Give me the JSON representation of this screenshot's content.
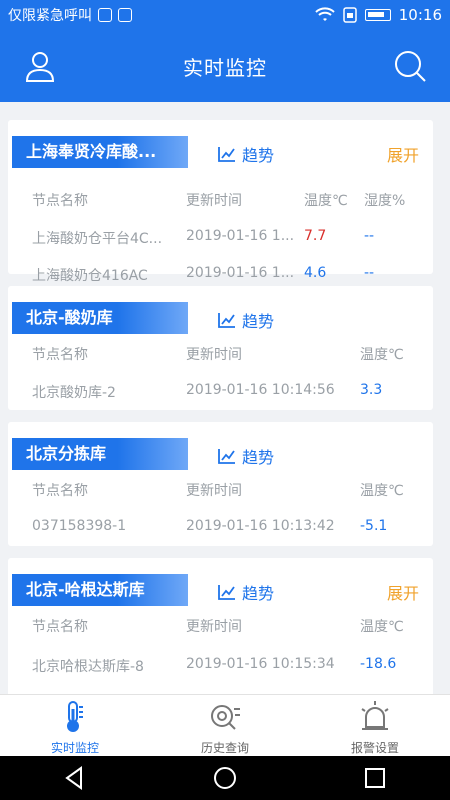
{
  "status_bar": {
    "carrier": "仅限紧急呼叫",
    "time": "10:16"
  },
  "header": {
    "title": "实时监控"
  },
  "cards": [
    {
      "name": "上海奉贤冷库酸...",
      "trend_label": "趋势",
      "expand_label": "展开",
      "headers": {
        "node": "节点名称",
        "time": "更新时间",
        "temp": "温度℃",
        "humidity": "湿度%"
      },
      "rows": [
        {
          "node": "上海酸奶仓平台4C...",
          "time": "2019-01-16 1...",
          "temp": "7.7",
          "humidity": "--"
        },
        {
          "node": "上海酸奶仓416AC",
          "time": "2019-01-16 1...",
          "temp": "4.6",
          "humidity": "--"
        }
      ]
    },
    {
      "name": "北京-酸奶库",
      "trend_label": "趋势",
      "headers": {
        "node": "节点名称",
        "time": "更新时间",
        "temp": "温度℃"
      },
      "rows": [
        {
          "node": "北京酸奶库-2",
          "time": "2019-01-16 10:14:56",
          "temp": "3.3"
        }
      ]
    },
    {
      "name": "北京分拣库",
      "trend_label": "趋势",
      "headers": {
        "node": "节点名称",
        "time": "更新时间",
        "temp": "温度℃"
      },
      "rows": [
        {
          "node": "037158398-1",
          "time": "2019-01-16 10:13:42",
          "temp": "-5.1"
        }
      ]
    },
    {
      "name": "北京-哈根达斯库",
      "trend_label": "趋势",
      "expand_label": "展开",
      "headers": {
        "node": "节点名称",
        "time": "更新时间",
        "temp": "温度℃"
      },
      "rows": [
        {
          "node": "北京哈根达斯库-8",
          "time": "2019-01-16 10:15:34",
          "temp": "-18.6"
        }
      ]
    }
  ],
  "bottom_nav": [
    {
      "label": "实时监控",
      "active": true
    },
    {
      "label": "历史查询",
      "active": false
    },
    {
      "label": "报警设置",
      "active": false
    }
  ],
  "colors": {
    "primary": "#1f74ea",
    "warning_value": "#d9302c",
    "expand": "#f0a22b"
  }
}
